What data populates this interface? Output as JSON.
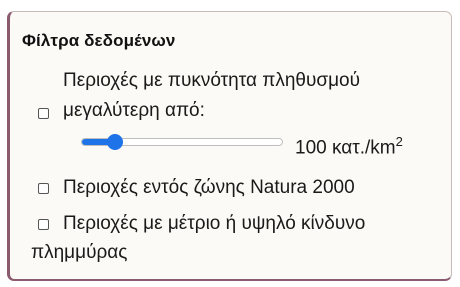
{
  "filters": {
    "title": "Φίλτρα δεδομένων",
    "density": {
      "label_line1": "Περιοχές με πυκνότητα πληθυσμού",
      "label_line2": "μεγαλύτερη από:",
      "checked": false,
      "slider_fraction": 0.13,
      "value_text": "100 κατ./km",
      "value_sup": "2",
      "accent_color": "#1e73e8"
    },
    "natura": {
      "label": "Περιοχές εντός ζώνης Natura 2000",
      "checked": false
    },
    "flood": {
      "label_line1": "Περιοχές με μέτριο ή υψηλό κίνδυνο",
      "label_line2": "πλημμύρας",
      "checked": false
    }
  }
}
